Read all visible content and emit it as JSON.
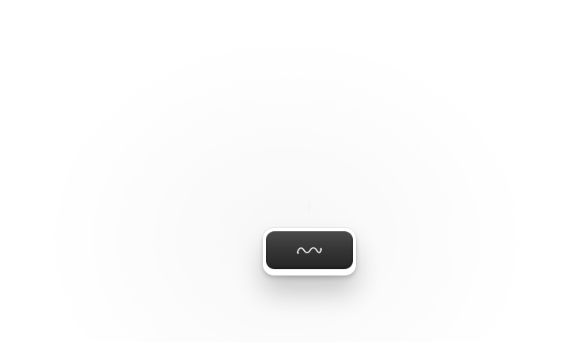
{
  "button": {
    "icon": "wave-icon",
    "colors": {
      "face_top": "#4a4a4a",
      "face_bottom": "#262626",
      "frame": "#ffffff",
      "icon": "#ffffff"
    }
  }
}
